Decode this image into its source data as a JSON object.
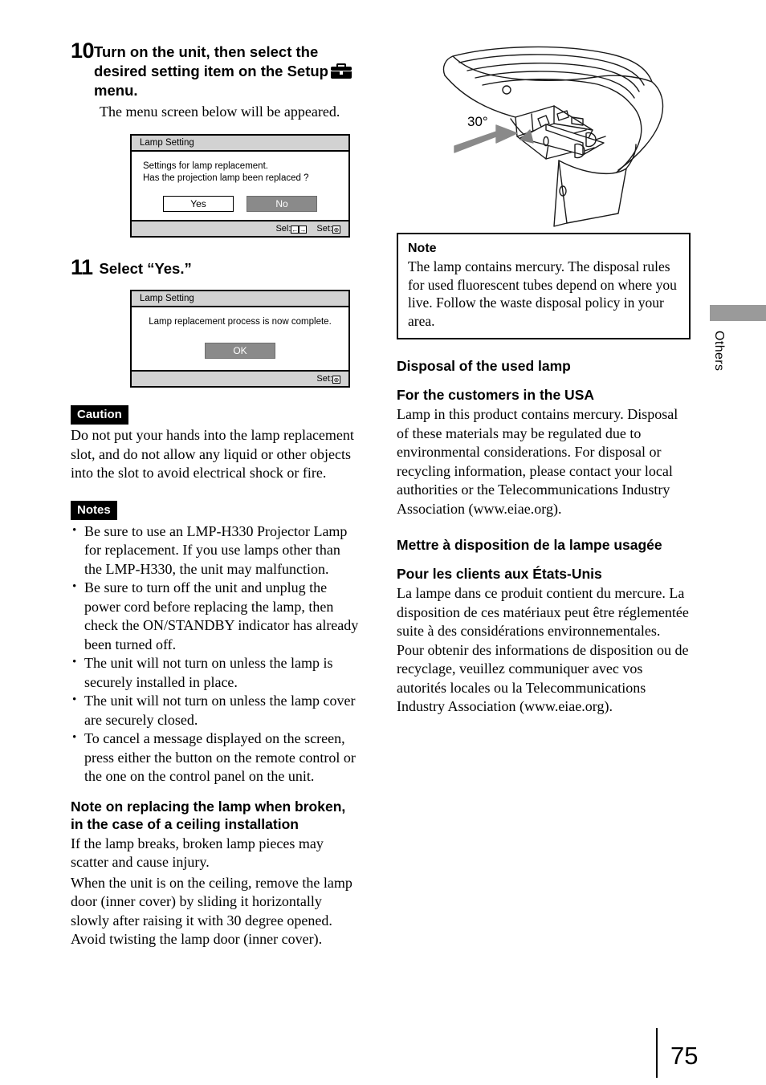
{
  "page": {
    "number": "75",
    "side_tab_label": "Others"
  },
  "left_column": {
    "step10": {
      "number": "10",
      "title_before_icon": "Turn on the unit, then select the desired setting item on the Setup",
      "icon_name": "setup-toolbox-icon",
      "title_after_icon": "menu.",
      "body": "The menu screen below will be appeared."
    },
    "osd1": {
      "title": "Lamp Setting",
      "line1": "Settings for lamp replacement.",
      "line2": "Has the projection lamp been replaced ?",
      "button_yes": "Yes",
      "button_no": "No",
      "footer_sel_label": "Sel:",
      "footer_sel_glyph_left": "←",
      "footer_sel_glyph_right": "→",
      "footer_set_label": "Set:",
      "footer_set_glyph": "⊕"
    },
    "step11": {
      "number": "11",
      "title": "Select “Yes.”"
    },
    "osd2": {
      "title": "Lamp Setting",
      "line1": "Lamp replacement process is now complete.",
      "button_ok": "OK",
      "footer_set_label": "Set:",
      "footer_set_glyph": "⊕"
    },
    "caution": {
      "tag": "Caution",
      "text": "Do not put your hands into the lamp replacement slot, and do not allow any liquid or other objects into the slot to avoid electrical shock or fire."
    },
    "notes": {
      "tag": "Notes",
      "items": [
        "Be sure to use an LMP-H330 Projector Lamp for replacement. If you use lamps other than the LMP-H330, the unit may malfunction.",
        "Be sure to turn off the unit and unplug the power cord before replacing the lamp, then check the ON/STANDBY indicator has already been turned off.",
        "The unit will not turn on unless the lamp is securely installed in place.",
        "The unit will not turn on unless the lamp cover are securely closed.",
        "To cancel a message displayed on the screen, press either the button on the remote control or the one on the control panel on the unit."
      ]
    },
    "ceiling_note": {
      "heading": "Note on replacing the lamp when broken, in the case of a ceiling installation",
      "para1": "If the lamp breaks, broken lamp pieces may scatter and cause injury.",
      "para2": "When the unit is on the ceiling, remove the lamp door (inner cover) by sliding it horizontally slowly after raising it with 30 degree opened. Avoid twisting the lamp door (inner cover)."
    }
  },
  "right_column": {
    "illustration": {
      "name": "projector-lamp-door-30-degree-diagram",
      "angle_label": "30°"
    },
    "note_box": {
      "title": "Note",
      "text": "The lamp contains mercury. The disposal rules for used fluorescent tubes depend on where you live. Follow the waste disposal policy in your area."
    },
    "disposal": {
      "heading": "Disposal of the used lamp",
      "usa_heading": "For the customers in the USA",
      "usa_text": "Lamp in this product contains mercury. Disposal of these materials may be regulated due to environmental considerations. For disposal or recycling information, please contact your local authorities or the Telecommunications Industry Association (www.eiae.org)."
    },
    "disposal_fr": {
      "heading": "Mettre à disposition de la lampe usagée",
      "usa_heading": "Pour les clients aux États-Unis",
      "usa_text": "La lampe dans ce produit contient du mercure. La disposition de ces matériaux peut être réglementée suite à des considérations environnementales. Pour obtenir des informations de disposition ou de recyclage, veuillez communiquer avec vos autorités locales ou la Telecommunications Industry Association (www.eiae.org)."
    }
  },
  "colors": {
    "osd_title_bar": "#d2d2d2",
    "osd_selected_button": "#8a8a8a",
    "side_tab": "#9a9a9a",
    "tag_background": "#000000"
  }
}
